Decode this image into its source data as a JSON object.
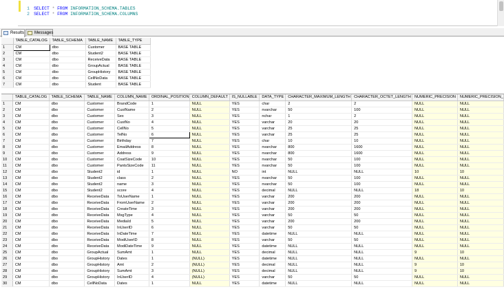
{
  "editor": {
    "lines": [
      {
        "num": "1",
        "select": "SELECT",
        "star": "*",
        "from": "FROM",
        "obj": "INFORMATION_SCHEMA.TABLES"
      },
      {
        "num": "2",
        "select": "SELECT",
        "star": "*",
        "from": "FROM",
        "obj": "INFORMATION_SCHEMA.COLUMNS"
      }
    ]
  },
  "tabs": [
    {
      "label": "Results"
    },
    {
      "label": "Messages"
    }
  ],
  "grid1": {
    "columns": [
      "TABLE_CATALOG",
      "TABLE_SCHEMA",
      "TABLE_NAME",
      "TABLE_TYPE"
    ],
    "rows": [
      [
        "1",
        "CM",
        "dbo",
        "Customer",
        "BASE TABLE"
      ],
      [
        "2",
        "CM",
        "dbo",
        "Student2",
        "BASE TABLE"
      ],
      [
        "3",
        "CM",
        "dbo",
        "ReceiveData",
        "BASE TABLE"
      ],
      [
        "4",
        "CM",
        "dbo",
        "GroupActual",
        "BASE TABLE"
      ],
      [
        "5",
        "CM",
        "dbo",
        "GroupHistory",
        "BASE TABLE"
      ],
      [
        "6",
        "CM",
        "dbo",
        "CellNoData",
        "BASE TABLE"
      ],
      [
        "7",
        "CM",
        "dbo",
        "Student",
        "BASE TABLE"
      ]
    ]
  },
  "grid2": {
    "columns": [
      "TABLE_CATALOG",
      "TABLE_SCHEMA",
      "TABLE_NAME",
      "COLUMN_NAME",
      "ORDINAL_POSITION",
      "COLUMN_DEFAULT",
      "IS_NULLABLE",
      "DATA_TYPE",
      "CHARACTER_MAXIMUM_LENGTH",
      "CHARACTER_OCTET_LENGTH",
      "NUMERIC_PRECISION",
      "NUMERIC_PRECISION_"
    ],
    "rows": [
      [
        "1",
        "CM",
        "dbo",
        "Customer",
        "BrandCode",
        "1",
        "NULL",
        "YES",
        "char",
        "2",
        "2",
        "NULL",
        "NULL"
      ],
      [
        "2",
        "CM",
        "dbo",
        "Customer",
        "CustName",
        "2",
        "NULL",
        "YES",
        "nvarchar",
        "50",
        "100",
        "NULL",
        "NULL"
      ],
      [
        "3",
        "CM",
        "dbo",
        "Customer",
        "Sex",
        "3",
        "NULL",
        "YES",
        "nchar",
        "1",
        "2",
        "NULL",
        "NULL"
      ],
      [
        "4",
        "CM",
        "dbo",
        "Customer",
        "CustNo",
        "4",
        "NULL",
        "YES",
        "varchar",
        "20",
        "20",
        "NULL",
        "NULL"
      ],
      [
        "5",
        "CM",
        "dbo",
        "Customer",
        "CellNo",
        "5",
        "NULL",
        "YES",
        "varchar",
        "25",
        "25",
        "NULL",
        "NULL"
      ],
      [
        "6",
        "CM",
        "dbo",
        "Customer",
        "TelNo",
        "6",
        "NULL",
        "YES",
        "varchar",
        "25",
        "25",
        "NULL",
        "NULL"
      ],
      [
        "7",
        "CM",
        "dbo",
        "Customer",
        "Birthday",
        "7",
        "NULL",
        "YES",
        "char",
        "10",
        "10",
        "NULL",
        "NULL"
      ],
      [
        "8",
        "CM",
        "dbo",
        "Customer",
        "EmailAddress",
        "8",
        "NULL",
        "YES",
        "nvarchar",
        "800",
        "1600",
        "NULL",
        "NULL"
      ],
      [
        "9",
        "CM",
        "dbo",
        "Customer",
        "Address",
        "9",
        "NULL",
        "YES",
        "nvarchar",
        "800",
        "1600",
        "NULL",
        "NULL"
      ],
      [
        "10",
        "CM",
        "dbo",
        "Customer",
        "CoatSizeCode",
        "10",
        "NULL",
        "YES",
        "nvarchar",
        "50",
        "100",
        "NULL",
        "NULL"
      ],
      [
        "11",
        "CM",
        "dbo",
        "Customer",
        "PantsSizeCode",
        "11",
        "NULL",
        "YES",
        "nvarchar",
        "50",
        "100",
        "NULL",
        "NULL"
      ],
      [
        "12",
        "CM",
        "dbo",
        "Student2",
        "id",
        "1",
        "NULL",
        "NO",
        "int",
        "NULL",
        "NULL",
        "10",
        "10"
      ],
      [
        "13",
        "CM",
        "dbo",
        "Student2",
        "class",
        "2",
        "NULL",
        "YES",
        "nvarchar",
        "50",
        "100",
        "NULL",
        "NULL"
      ],
      [
        "14",
        "CM",
        "dbo",
        "Student2",
        "name",
        "3",
        "NULL",
        "YES",
        "nvarchar",
        "50",
        "100",
        "NULL",
        "NULL"
      ],
      [
        "15",
        "CM",
        "dbo",
        "Student2",
        "score",
        "4",
        "NULL",
        "YES",
        "decimal",
        "NULL",
        "NULL",
        "18",
        "10"
      ],
      [
        "16",
        "CM",
        "dbo",
        "ReceiveData",
        "ToUserName",
        "1",
        "NULL",
        "YES",
        "varchar",
        "200",
        "200",
        "NULL",
        "NULL"
      ],
      [
        "17",
        "CM",
        "dbo",
        "ReceiveData",
        "FromUserName",
        "2",
        "NULL",
        "YES",
        "varchar",
        "200",
        "200",
        "NULL",
        "NULL"
      ],
      [
        "18",
        "CM",
        "dbo",
        "ReceiveData",
        "CreateTime",
        "3",
        "NULL",
        "YES",
        "varchar",
        "200",
        "200",
        "NULL",
        "NULL"
      ],
      [
        "19",
        "CM",
        "dbo",
        "ReceiveData",
        "MsgType",
        "4",
        "NULL",
        "YES",
        "varchar",
        "50",
        "50",
        "NULL",
        "NULL"
      ],
      [
        "20",
        "CM",
        "dbo",
        "ReceiveData",
        "MediaId",
        "5",
        "NULL",
        "YES",
        "varchar",
        "200",
        "200",
        "NULL",
        "NULL"
      ],
      [
        "21",
        "CM",
        "dbo",
        "ReceiveData",
        "InUserID",
        "6",
        "NULL",
        "YES",
        "varchar",
        "50",
        "50",
        "NULL",
        "NULL"
      ],
      [
        "22",
        "CM",
        "dbo",
        "ReceiveData",
        "InDateTime",
        "7",
        "NULL",
        "YES",
        "datetime",
        "NULL",
        "NULL",
        "NULL",
        "NULL"
      ],
      [
        "23",
        "CM",
        "dbo",
        "ReceiveData",
        "ModiUserID",
        "8",
        "NULL",
        "YES",
        "varchar",
        "50",
        "50",
        "NULL",
        "NULL"
      ],
      [
        "24",
        "CM",
        "dbo",
        "ReceiveData",
        "ModiDateTime",
        "9",
        "NULL",
        "YES",
        "datetime",
        "NULL",
        "NULL",
        "NULL",
        "NULL"
      ],
      [
        "25",
        "CM",
        "dbo",
        "GroupActual",
        "SumAmt",
        "1",
        "NULL",
        "YES",
        "decimal",
        "NULL",
        "NULL",
        "9",
        "10"
      ],
      [
        "26",
        "CM",
        "dbo",
        "GroupHistory",
        "Dates",
        "1",
        "(NULL)",
        "YES",
        "datetime",
        "NULL",
        "NULL",
        "NULL",
        "NULL"
      ],
      [
        "27",
        "CM",
        "dbo",
        "GroupHistory",
        "Amt",
        "2",
        "(NULL)",
        "YES",
        "decimal",
        "NULL",
        "NULL",
        "9",
        "10"
      ],
      [
        "28",
        "CM",
        "dbo",
        "GroupHistory",
        "SumAmt",
        "3",
        "(NULL)",
        "YES",
        "decimal",
        "NULL",
        "NULL",
        "9",
        "10"
      ],
      [
        "29",
        "CM",
        "dbo",
        "GroupHistory",
        "InUserID",
        "4",
        "(NULL)",
        "YES",
        "varchar",
        "50",
        "50",
        "NULL",
        "NULL"
      ],
      [
        "30",
        "CM",
        "dbo",
        "CellNoData",
        "Dates",
        "1",
        "NULL",
        "YES",
        "datetime",
        "NULL",
        "NULL",
        "NULL",
        "NULL"
      ]
    ]
  }
}
